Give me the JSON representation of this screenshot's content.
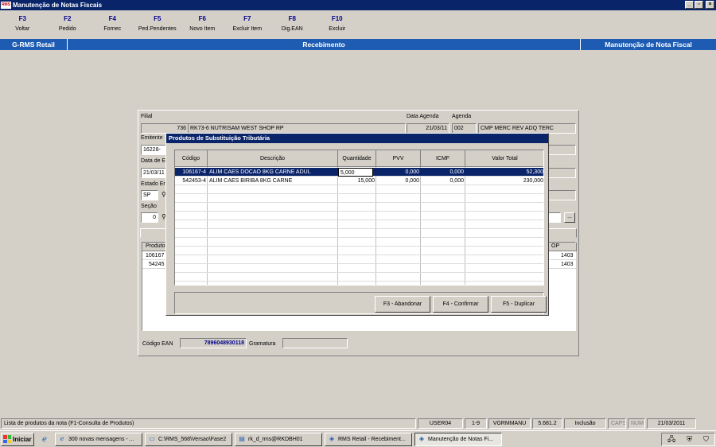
{
  "window": {
    "title": "Manutenção de Notas Fiscais",
    "app_icon_text": "RMS",
    "btn_min": "_",
    "btn_max": "▫",
    "btn_close": "×"
  },
  "fkeys": [
    {
      "key": "F3",
      "label": "Voltar"
    },
    {
      "key": "F2",
      "label": "Pedido"
    },
    {
      "key": "F4",
      "label": "Fornec"
    },
    {
      "key": "F5",
      "label": "Ped.Pendentes"
    },
    {
      "key": "F6",
      "label": "Novo Item"
    },
    {
      "key": "F7",
      "label": "Excluir Item"
    },
    {
      "key": "F8",
      "label": "Dig.EAN"
    },
    {
      "key": "F10",
      "label": "Excluir"
    }
  ],
  "band": {
    "left": "G-RMS Retail",
    "center": "Recebimento",
    "right": "Manutenção de Nota Fiscal"
  },
  "form": {
    "filial_label": "Filial",
    "filial_code": "736",
    "filial_name": "RK73-6 NUTRISAM WEST SHOP RP",
    "data_agenda_label": "Data Agenda",
    "data_agenda": "21/03/11",
    "agenda_label": "Agenda",
    "agenda_code": "002",
    "agenda_desc": "CMP MERC REV ADQ TERC",
    "emitente_label": "Emitente",
    "emitente_value": "16228-",
    "data_e_label": "Data de E",
    "data_e_value": "21/03/11",
    "estado_label": "Estado Er",
    "estado_value": "SP",
    "secao_label": "Seção",
    "secao_value": "0",
    "ellipsis_btn": "...",
    "grid_col_produto": "Produto",
    "grid_col_cfop": "OP",
    "grid_rows": [
      {
        "produto": "106167",
        "cfop": "1403"
      },
      {
        "produto": "54245",
        "cfop": "1403"
      }
    ],
    "codigo_ean_label": "Código EAN",
    "codigo_ean_value": "7896048930118",
    "gramatura_label": "Gramatura",
    "gramatura_value": ""
  },
  "modal": {
    "title": "Produtos de Substituição Tributária",
    "columns": [
      "Código",
      "Descrição",
      "Quantidade",
      "PVV",
      "ICMF",
      "Valor Total"
    ],
    "rows": [
      {
        "codigo": "106167-4",
        "descricao": "ALIM CAES DOCAO 8KG CARNE ADUL",
        "quantidade": "5,000",
        "pvv": "0,000",
        "icmf": "0,000",
        "valor_total": "52,300"
      },
      {
        "codigo": "542453-4",
        "descricao": "ALIM CAES BIRIBA 8KG CARNE",
        "quantidade": "15,000",
        "pvv": "0,000",
        "icmf": "0,000",
        "valor_total": "230,000"
      }
    ],
    "btn_abandonar": "F3 - Abandonar",
    "btn_confirmar": "F4 - Confirmar",
    "btn_duplicar": "F5 - Duplicar"
  },
  "status": {
    "message": "Lista de produtos da nota  (F1-Consulta de Produtos)",
    "user": "USER04",
    "range": "1-9",
    "program": "VGRMMANU",
    "version": "5.681.2",
    "mode": "Inclusão",
    "caps": "CAPS",
    "num": "NUM",
    "date": "21/03/2011"
  },
  "taskbar": {
    "start": "Iniciar",
    "tasks": [
      "300 novas mensagens - ...",
      "C:\\RMS_568\\Versao\\Fase2",
      "rk_d_rms@RKDBH01",
      "RMS Retail - Recebiment...",
      "Manutenção de Notas Fi..."
    ]
  }
}
